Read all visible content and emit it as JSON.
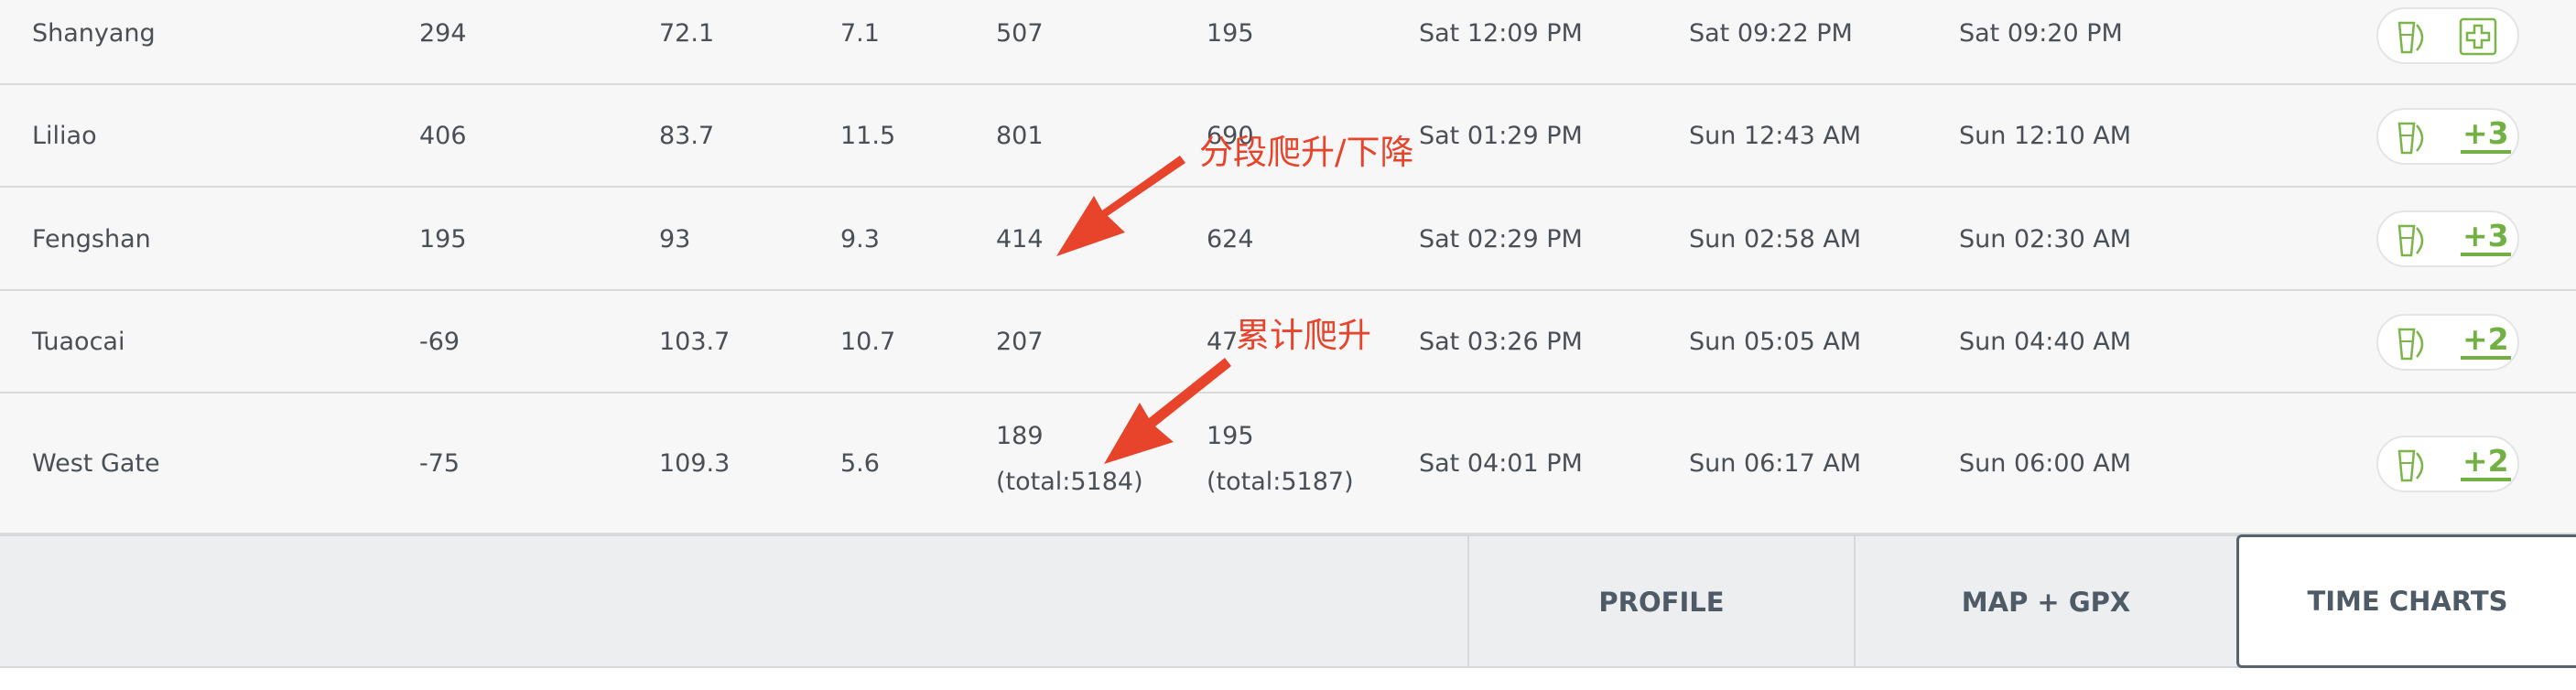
{
  "rows": [
    {
      "name": "Shanyang",
      "col1": "294",
      "col2": "72.1",
      "col3": "7.1",
      "col4": "507",
      "col5": "195",
      "col6": "Sat 12:09 PM",
      "col7": "Sat 09:22 PM",
      "col8": "Sat 09:20 PM",
      "aid_extra": ""
    },
    {
      "name": "Liliao",
      "col1": "406",
      "col2": "83.7",
      "col3": "11.5",
      "col4": "801",
      "col5": "690",
      "col6": "Sat 01:29 PM",
      "col7": "Sun 12:43 AM",
      "col8": "Sun 12:10 AM",
      "aid_extra": "+3"
    },
    {
      "name": "Fengshan",
      "col1": "195",
      "col2": "93",
      "col3": "9.3",
      "col4": "414",
      "col5": "624",
      "col6": "Sat 02:29 PM",
      "col7": "Sun 02:58 AM",
      "col8": "Sun 02:30 AM",
      "aid_extra": "+3"
    },
    {
      "name": "Tuaocai",
      "col1": "-69",
      "col2": "103.7",
      "col3": "10.7",
      "col4": "207",
      "col5": "47",
      "col6": "Sat 03:26 PM",
      "col7": "Sun 05:05 AM",
      "col8": "Sun 04:40 AM",
      "aid_extra": "+2"
    },
    {
      "name": "West Gate",
      "col1": "-75",
      "col2": "109.3",
      "col3": "5.6",
      "col4": "189",
      "col4_total": "(total:5184)",
      "col5": "195",
      "col5_total": "(total:5187)",
      "col6": "Sat 04:01 PM",
      "col7": "Sun 06:17 AM",
      "col8": "Sun 06:00 AM",
      "aid_extra": "+2"
    }
  ],
  "tabs": {
    "profile": "PROFILE",
    "map": "MAP + GPX",
    "time_charts": "TIME CHARTS",
    "selected": "time_charts"
  },
  "annotations": {
    "segment_climb_descent": "分段爬升/下降",
    "cumulative_climb": "累计爬升"
  },
  "colors": {
    "annotation": "#e8432b",
    "aid_green": "#72b043",
    "row_background": "#f7f7f7",
    "footer_background": "#eceeef",
    "text": "#4a4f55"
  },
  "icons": {
    "aid_drink": "drink-cup-icon",
    "aid_medical": "first-aid-cross-icon"
  }
}
